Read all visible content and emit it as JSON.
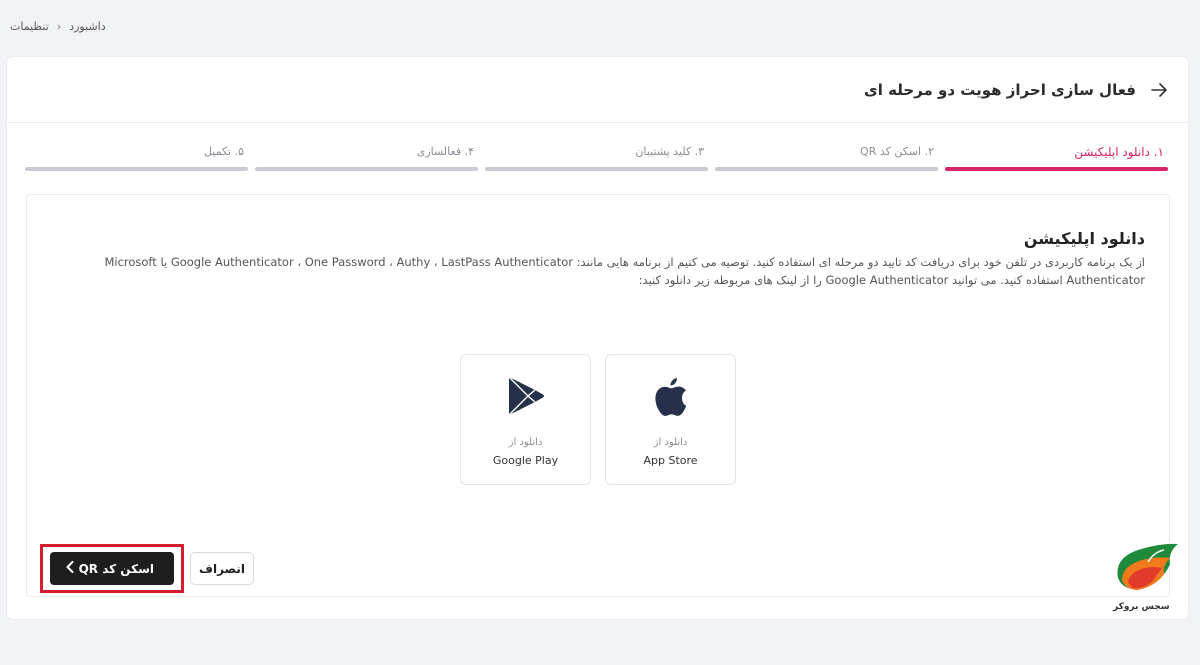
{
  "breadcrumb": {
    "items": [
      "داشبورد",
      "تنظیمات"
    ],
    "separator": "›"
  },
  "header": {
    "title": "فعال سازی احراز هویت دو مرحله ای"
  },
  "stepper": {
    "steps": [
      {
        "label": "۱. دانلود اپلیکیشن",
        "active": true
      },
      {
        "label": "۲. اسکن کد QR",
        "active": false
      },
      {
        "label": "۳. کلید پشتیبان",
        "active": false
      },
      {
        "label": "۴. فعالسازی",
        "active": false
      },
      {
        "label": "۵. تکمیل",
        "active": false
      }
    ]
  },
  "content": {
    "title": "دانلود اپلیکیشن",
    "description_line1": "از یک برنامه کاربردی در تلفن خود برای دریافت کد تایید دو مرحله ای استفاده کنید. توصیه می کنیم از برنامه هایی مانند: Google Authenticator ، One Password ، Authy ، LastPass Authenticator یا Microsoft",
    "description_line2": "Authenticator استفاده کنید. می توانید Google Authenticator را از لینک های مربوطه زیر دانلود کنید:"
  },
  "stores": {
    "app_store": {
      "from": "دانلود از",
      "name": "App Store",
      "icon": "apple-icon"
    },
    "google_play": {
      "from": "دانلود از",
      "name": "Google Play",
      "icon": "google-play-icon"
    }
  },
  "actions": {
    "next_label": "اسکن کد QR",
    "cancel_label": "انصراف"
  },
  "watermark": {
    "text": "سجس بروکر"
  },
  "colors": {
    "accent": "#d6236a",
    "primary_button": "#1e1e1e",
    "highlight": "#d21f2b",
    "background": "#f2f3f6"
  }
}
